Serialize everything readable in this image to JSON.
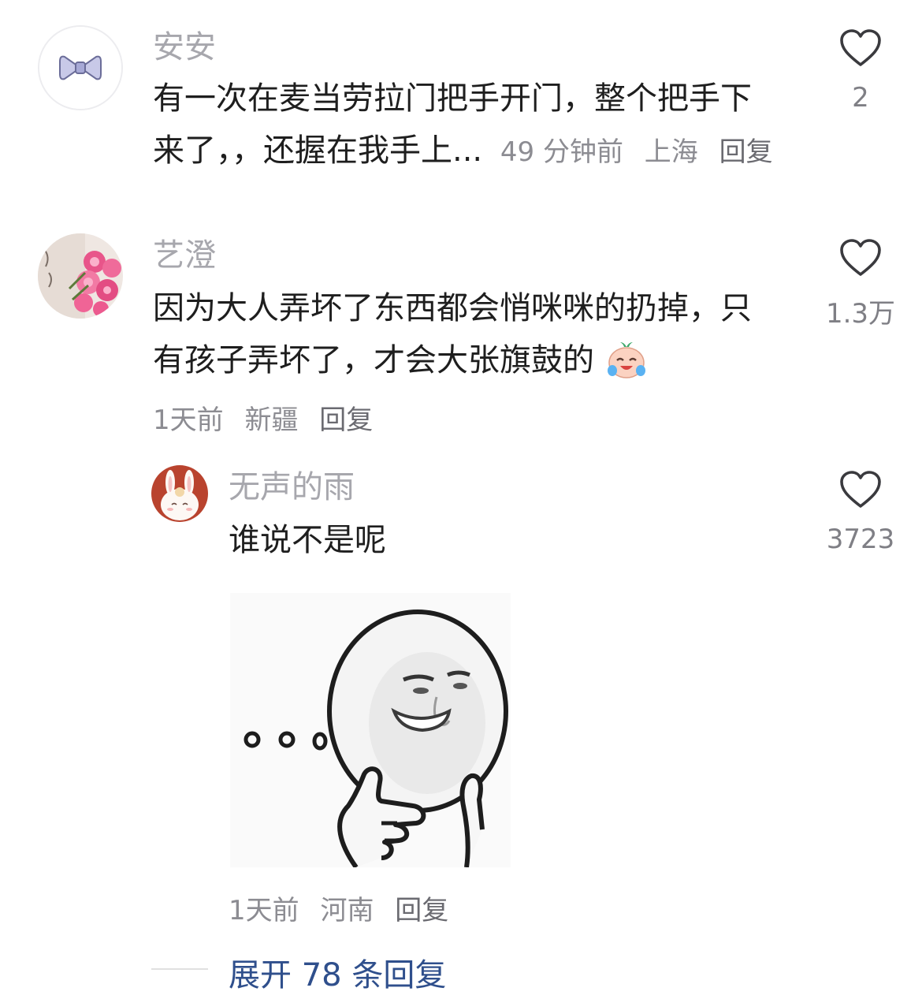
{
  "comments": [
    {
      "username": "安安",
      "text_line1": "有一次在麦当劳拉门把手开门，整个把手下",
      "text_line2": "来了，，还握在我手上...",
      "time": "49 分钟前",
      "location": "上海",
      "reply_label": "回复",
      "likes": "2",
      "avatar_icon": "bow-icon"
    },
    {
      "username": "艺澄",
      "text_line1": "因为大人弄坏了东西都会悄咪咪的扔掉，只",
      "text_line2": "有孩子弄坏了，才会大张旗鼓的",
      "time": "1天前",
      "location": "新疆",
      "reply_label": "回复",
      "likes": "1.3万",
      "avatar_icon": "flowers-photo"
    }
  ],
  "reply": {
    "username": "无声的雨",
    "text": "谁说不是呢",
    "time": "1天前",
    "location": "河南",
    "reply_label": "回复",
    "likes": "3723",
    "avatar_icon": "bunny-icon",
    "sticker": "thinking-face-sticker"
  },
  "expand": {
    "label": "展开 78 条回复"
  },
  "colors": {
    "username": "#a7a7ad",
    "text": "#1e1e1e",
    "meta": "#8c8c92",
    "expand": "#2f4f8c"
  }
}
